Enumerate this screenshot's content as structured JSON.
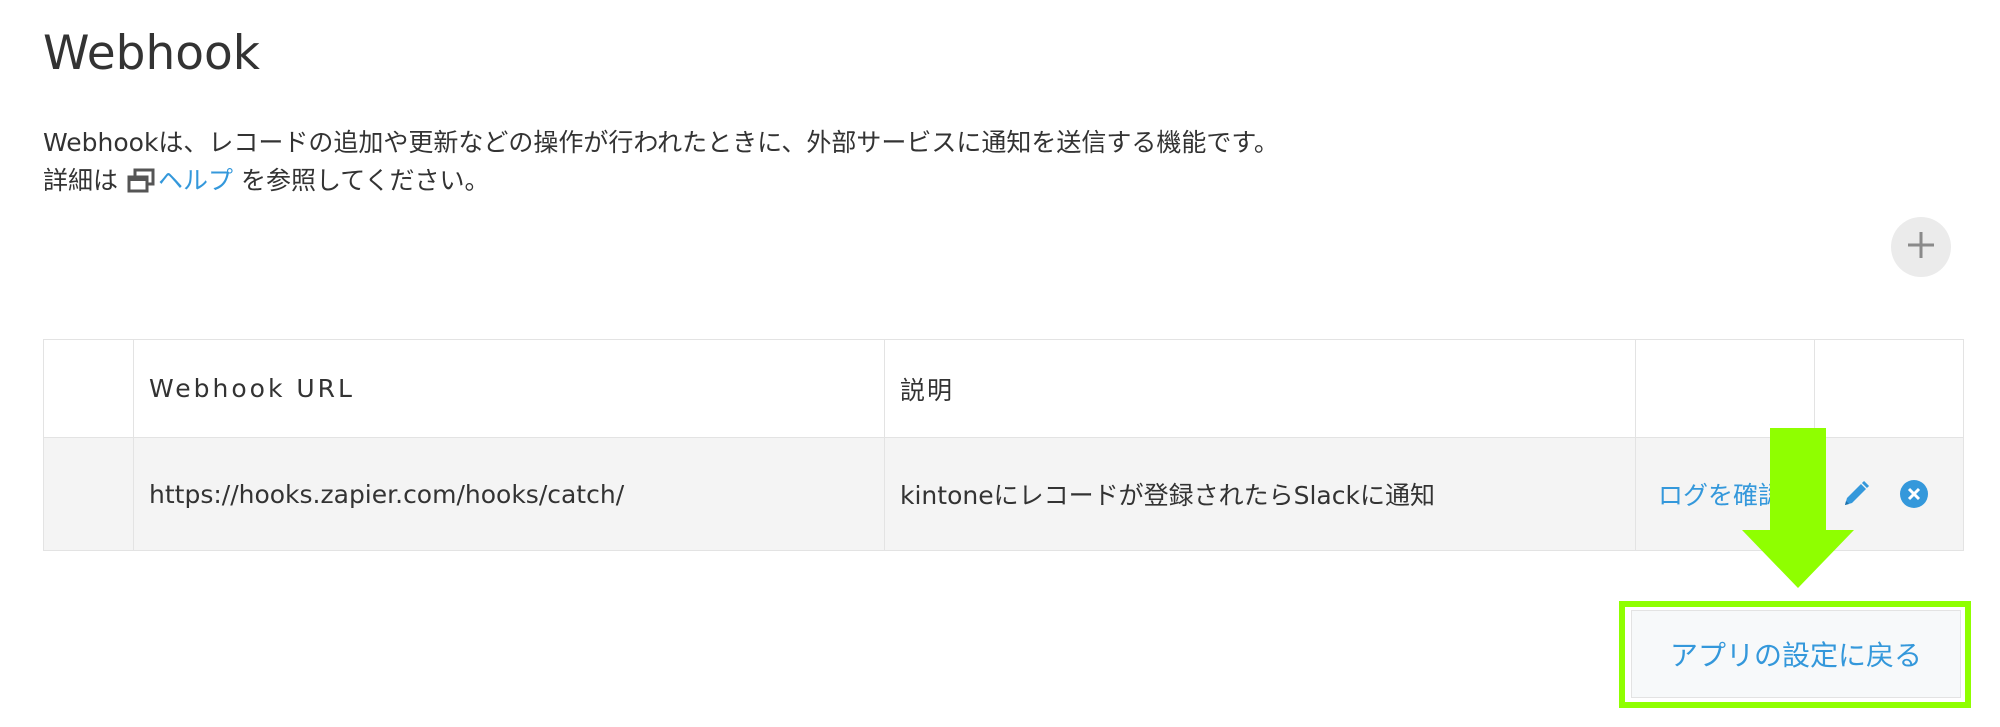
{
  "page": {
    "title": "Webhook"
  },
  "intro": {
    "line1": "Webhookは、レコードの追加や更新などの操作が行われたときに、外部サービスに通知を送信する機能です。",
    "line2_prefix": "詳細は",
    "help_link": "ヘルプ",
    "line2_suffix": " を参照してください。"
  },
  "toolbar": {
    "add_icon": "plus-icon"
  },
  "table": {
    "headers": {
      "url": "Webhook URL",
      "description": "説明"
    },
    "rows": [
      {
        "url": "https://hooks.zapier.com/hooks/catch/",
        "description": "kintoneにレコードが登録されたらSlackに通知",
        "log_link": "ログを確認",
        "edit_icon": "pencil-icon",
        "delete_icon": "close-circle-icon"
      }
    ]
  },
  "footer": {
    "back_button": "アプリの設定に戻る"
  },
  "colors": {
    "link": "#3498db",
    "highlight": "#8fff00",
    "row_bg": "#f4f4f4",
    "border": "#e3e3e3"
  }
}
